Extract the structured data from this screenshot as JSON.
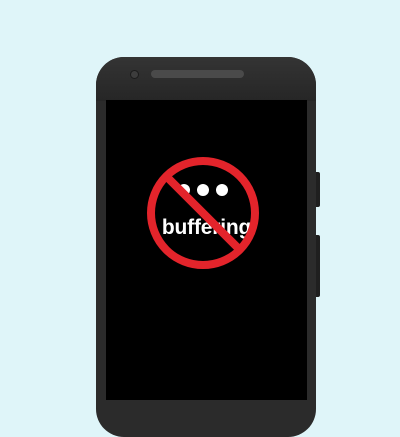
{
  "screen": {
    "loading_label": "buffering",
    "dots_count": 3
  },
  "icons": {
    "prohibition": "no-sign-icon",
    "loading": "ellipsis-dots-icon"
  },
  "colors": {
    "background": "#dff5f9",
    "phone_body": "#2b2b2b",
    "screen": "#000000",
    "prohibition_red": "#e3242b",
    "text": "#ffffff"
  }
}
